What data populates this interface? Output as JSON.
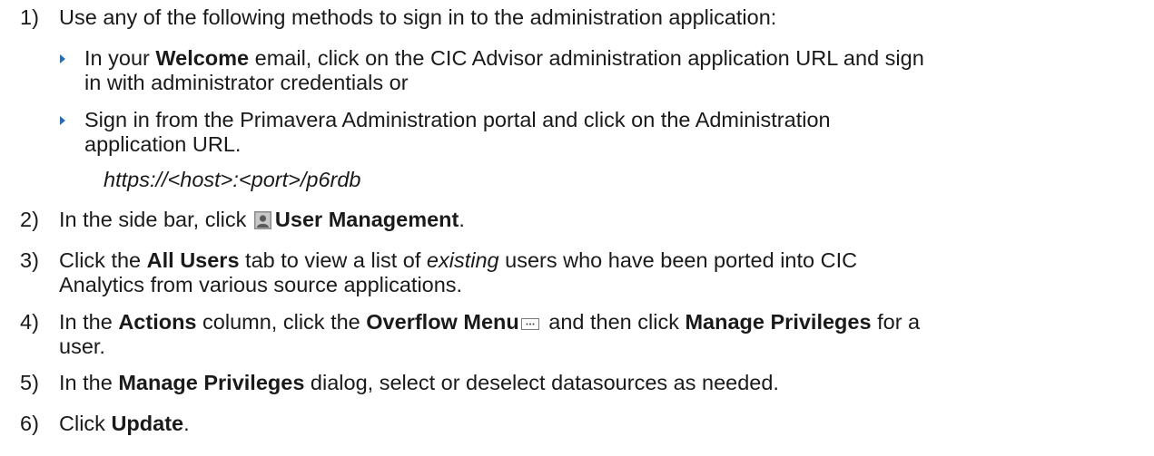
{
  "steps": [
    {
      "num": "1)",
      "text": "Use any of the following methods to sign in to the administration application:"
    },
    {
      "num": "2)",
      "pre": "In the side bar, click",
      "icon": "user-management-icon",
      "bold": "User Management",
      "post": "."
    },
    {
      "num": "3)",
      "pre": "Click the ",
      "bold": "All Users",
      "mid": " tab to view a list of ",
      "italic": "existing",
      "post": " users who have been ported into CIC",
      "line2": "Analytics from various source applications."
    },
    {
      "num": "4)",
      "pre": "In the ",
      "bold1": "Actions",
      "mid1": " column, click the ",
      "bold2": "Overflow Menu",
      "icon": "overflow-menu-icon",
      "mid2": " and then click ",
      "bold3": "Manage Privileges",
      "post": " for a",
      "line2": "user."
    },
    {
      "num": "5)",
      "pre": "In the ",
      "bold": "Manage Privileges",
      "post": " dialog, select or deselect datasources as needed."
    },
    {
      "num": "6)",
      "pre": "Click ",
      "bold": "Update",
      "post": "."
    }
  ],
  "bullets": [
    {
      "pre": "In your ",
      "bold": "Welcome",
      "post": " email, click on the CIC Advisor administration application URL and sign",
      "line2": "in with administrator credentials or"
    },
    {
      "line1": "Sign in from the Primavera Administration portal and click on the Administration",
      "line2": "application URL."
    }
  ],
  "url": "https://<host>:<port>/p6rdb",
  "colors": {
    "bullet": "#2b6cb0",
    "text": "#1a1a1a"
  }
}
